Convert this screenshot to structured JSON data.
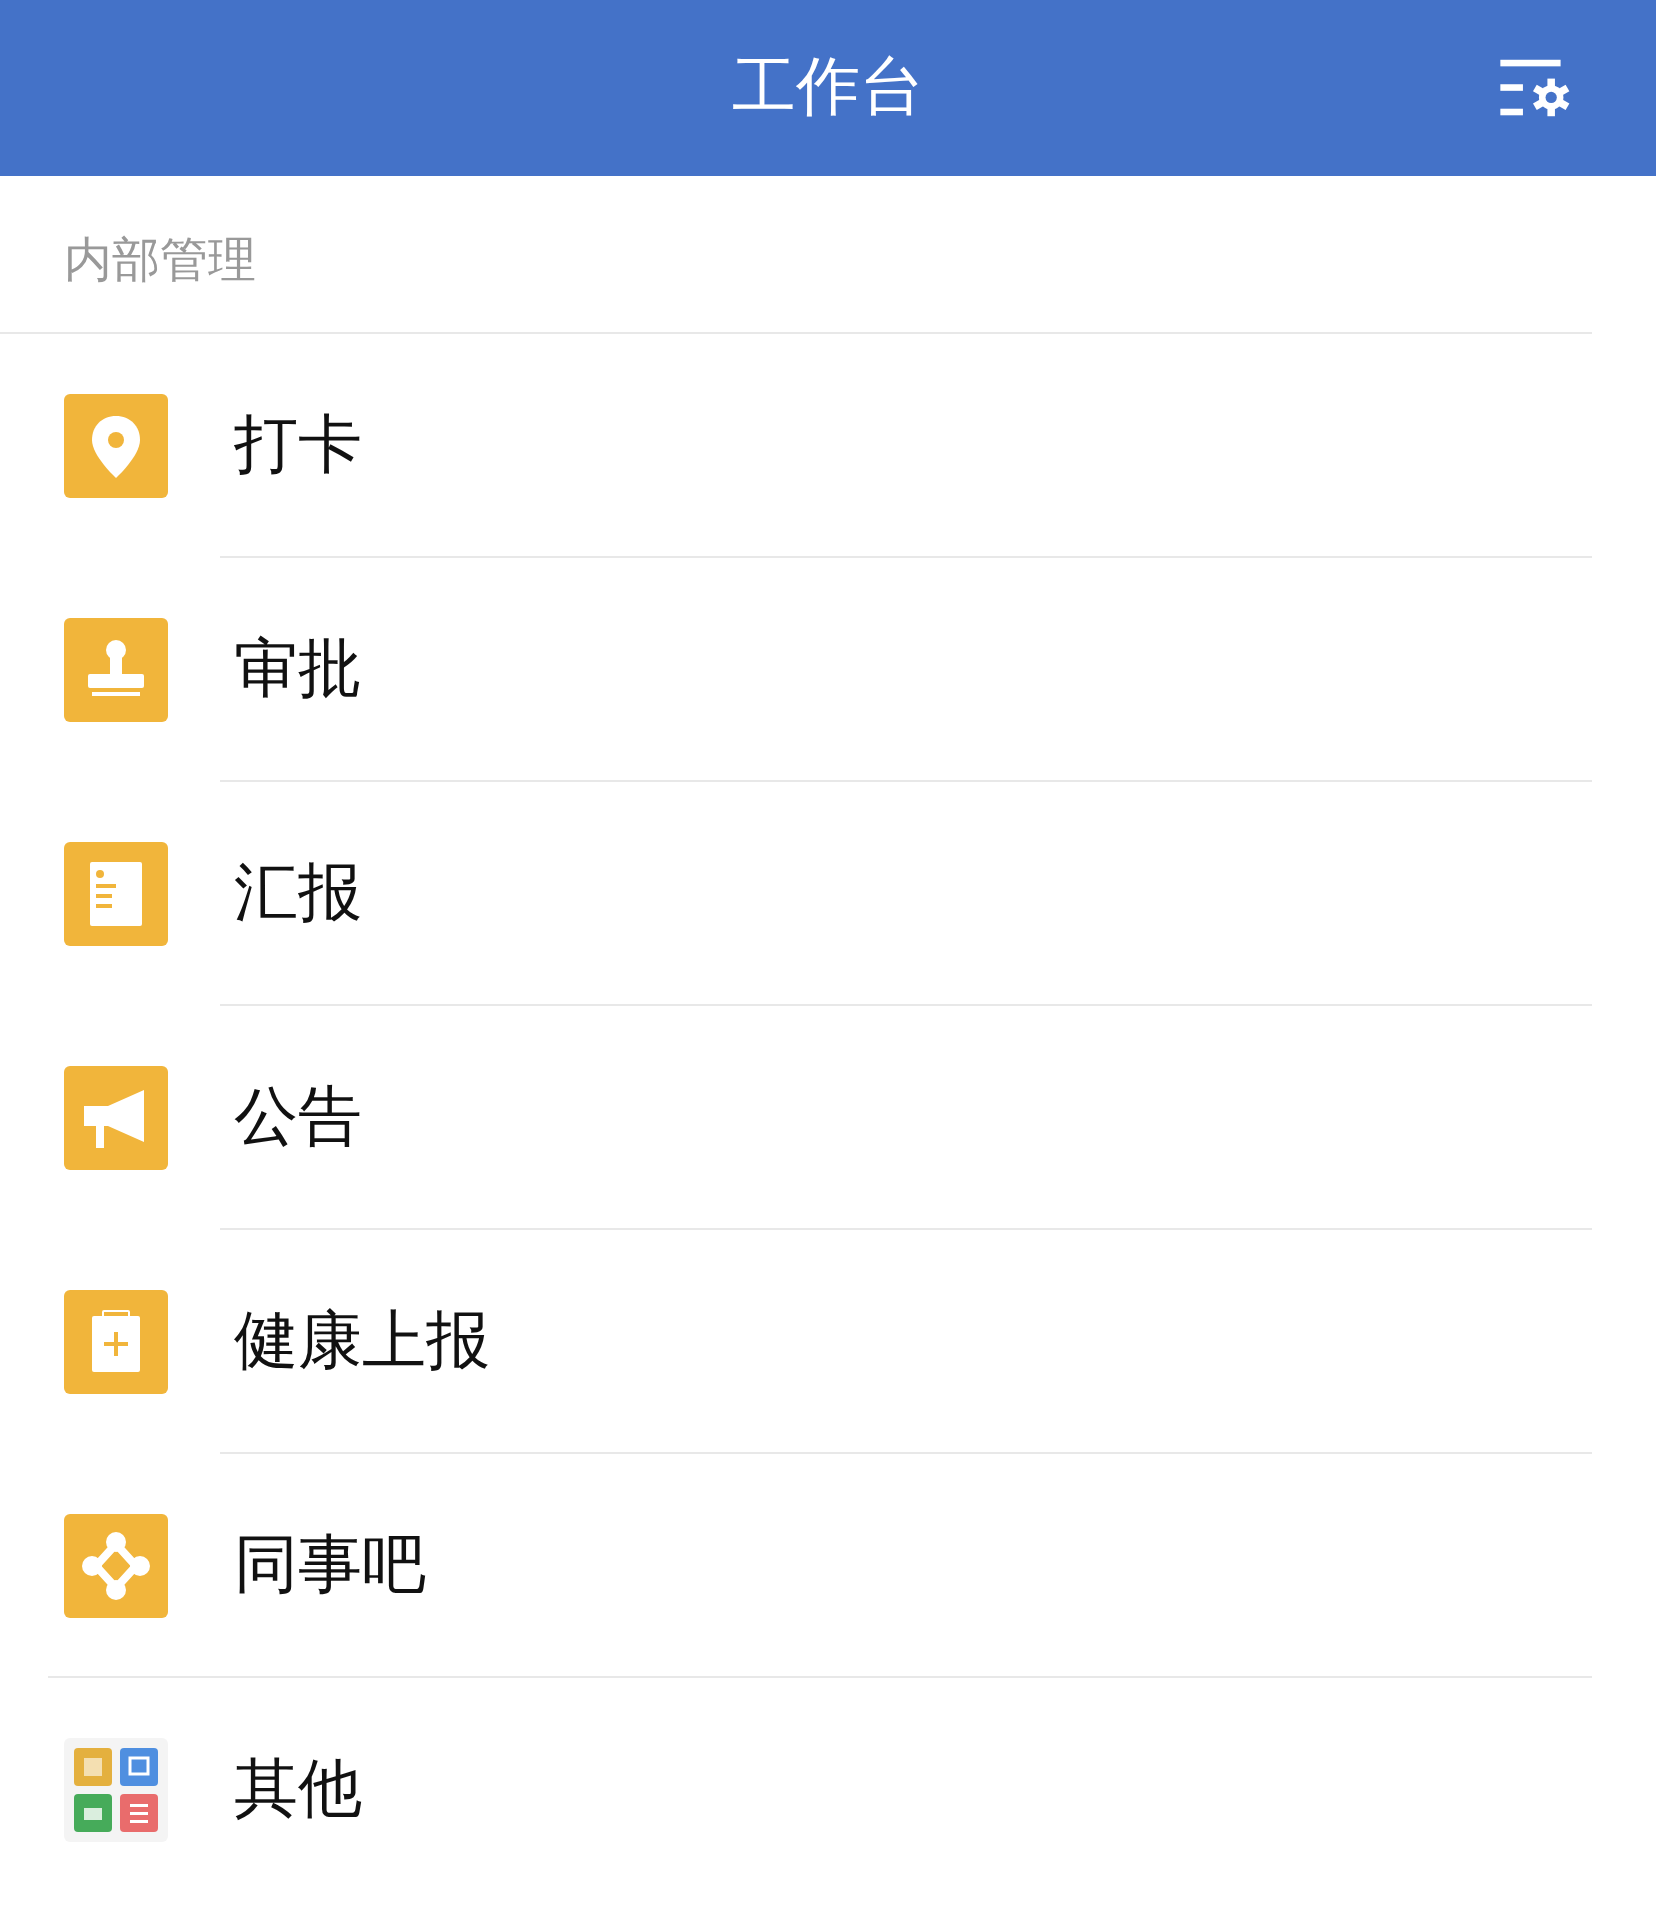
{
  "header": {
    "title": "工作台"
  },
  "section": {
    "title": "内部管理"
  },
  "items": [
    {
      "kind": "pin",
      "label": "打卡"
    },
    {
      "kind": "stamp",
      "label": "审批"
    },
    {
      "kind": "report",
      "label": "汇报"
    },
    {
      "kind": "megaphone",
      "label": "公告"
    },
    {
      "kind": "clipboard",
      "label": "健康上报"
    },
    {
      "kind": "network",
      "label": "同事吧"
    },
    {
      "kind": "grid",
      "label": "其他"
    }
  ]
}
